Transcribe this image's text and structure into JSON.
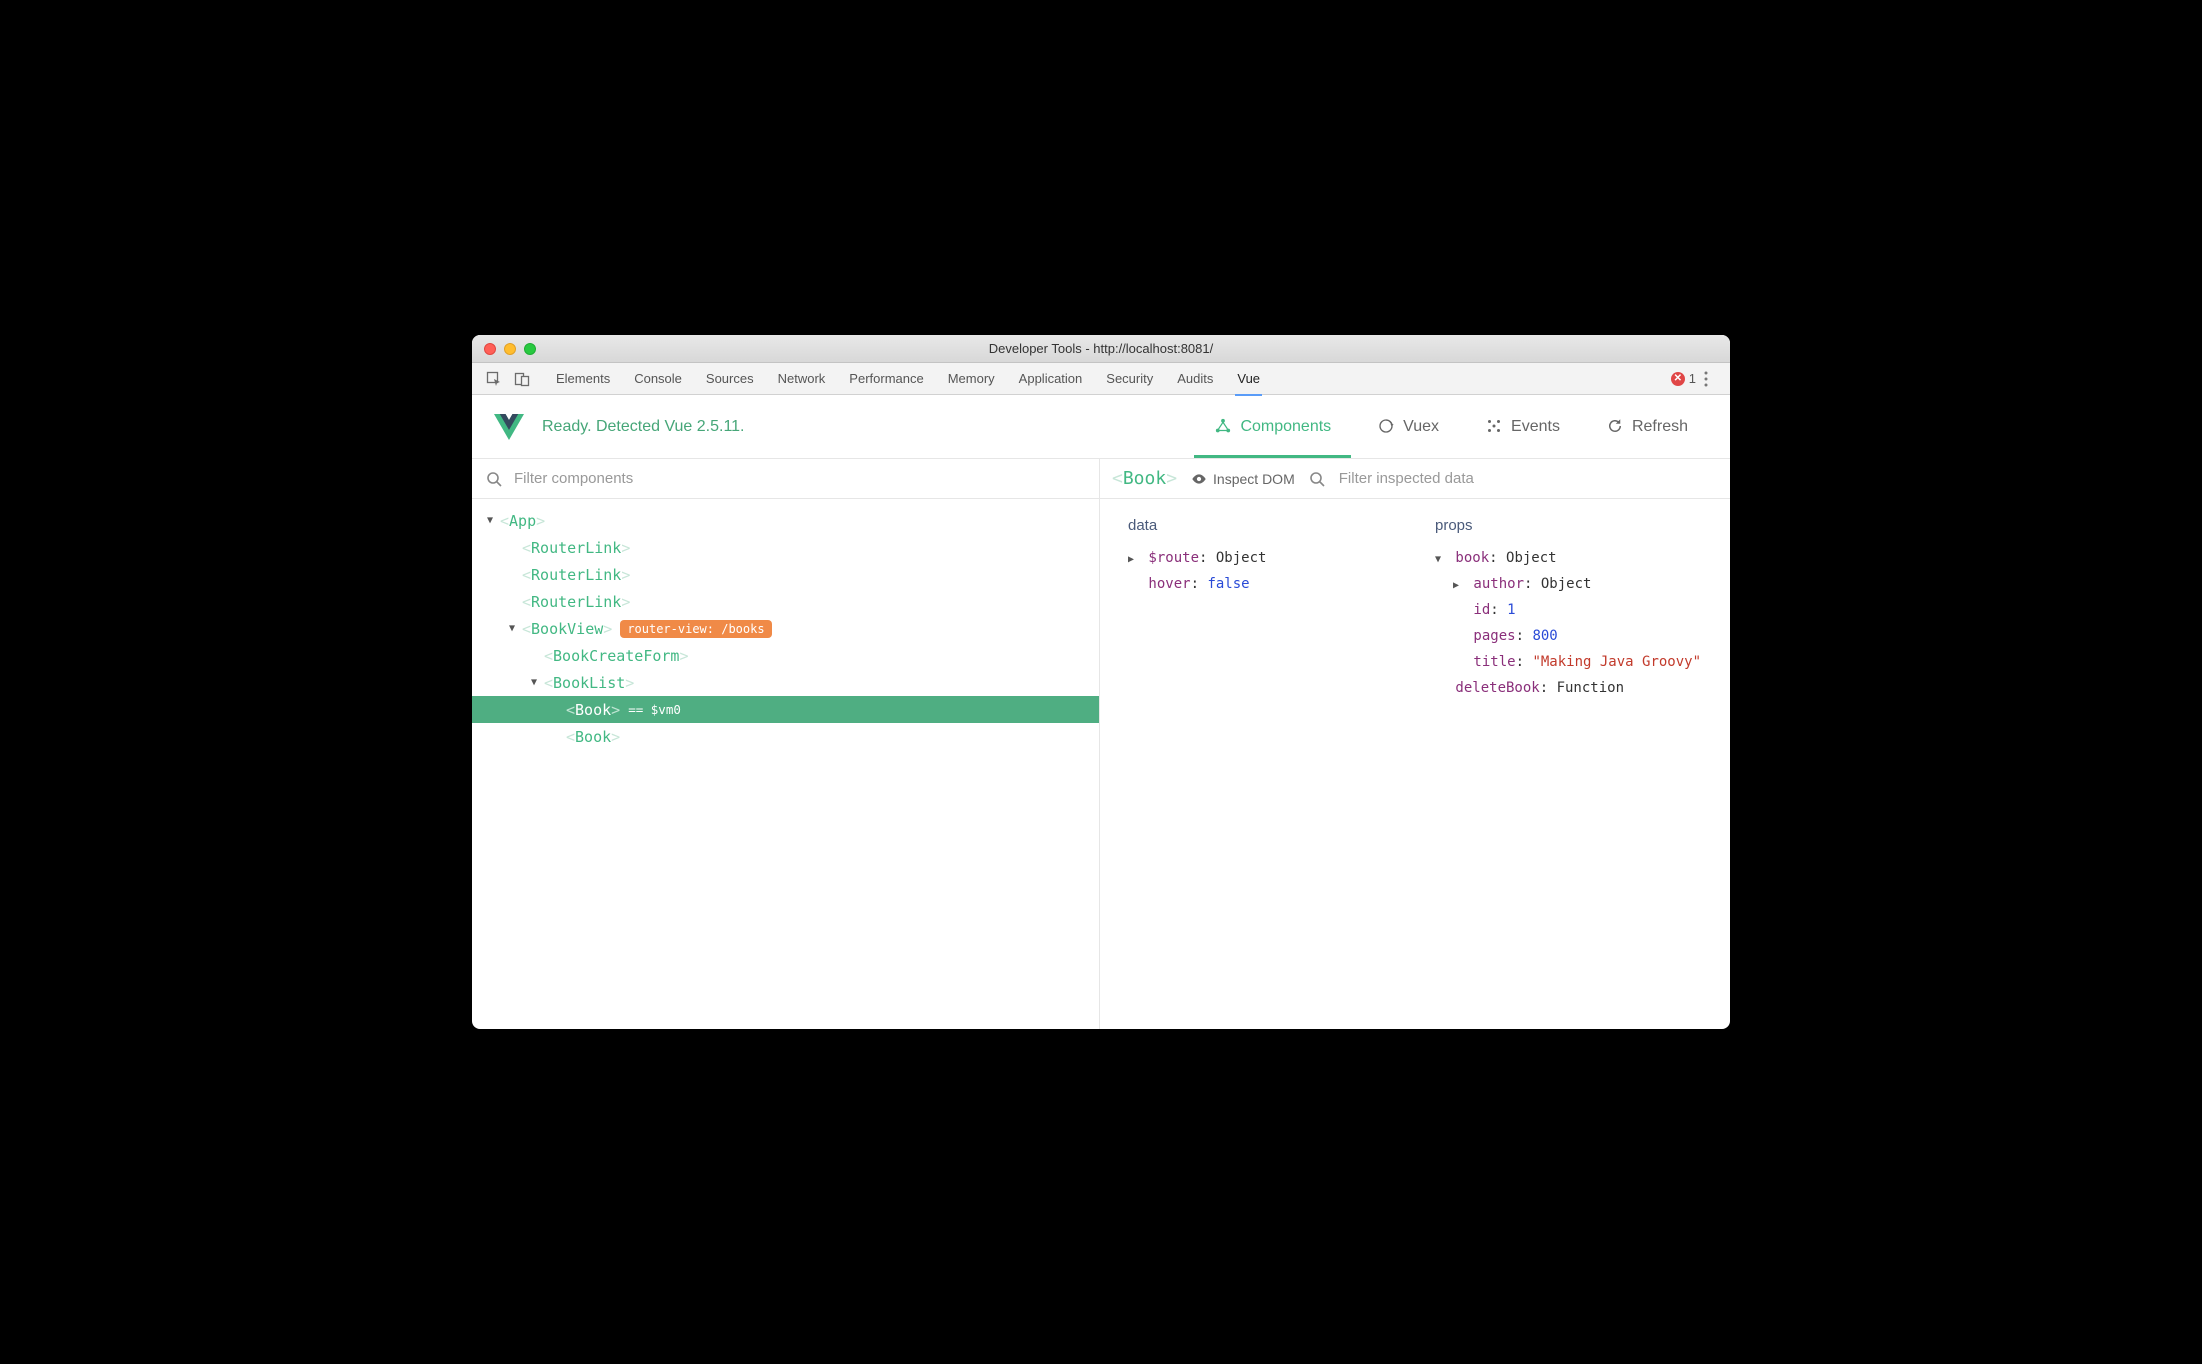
{
  "window": {
    "title": "Developer Tools - http://localhost:8081/"
  },
  "devtools": {
    "tabs": [
      "Elements",
      "Console",
      "Sources",
      "Network",
      "Performance",
      "Memory",
      "Application",
      "Security",
      "Audits",
      "Vue"
    ],
    "active_tab": "Vue",
    "error_count": "1"
  },
  "vue_status": {
    "message": "Ready. Detected Vue 2.5.11.",
    "tabs": [
      {
        "label": "Components",
        "active": true
      },
      {
        "label": "Vuex",
        "active": false
      },
      {
        "label": "Events",
        "active": false
      },
      {
        "label": "Refresh",
        "active": false
      }
    ]
  },
  "tree": {
    "filter_placeholder": "Filter components",
    "nodes": [
      {
        "depth": 0,
        "arrow": "down",
        "name": "App",
        "selected": false
      },
      {
        "depth": 1,
        "arrow": "none",
        "name": "RouterLink",
        "selected": false
      },
      {
        "depth": 1,
        "arrow": "none",
        "name": "RouterLink",
        "selected": false
      },
      {
        "depth": 1,
        "arrow": "none",
        "name": "RouterLink",
        "selected": false
      },
      {
        "depth": 1,
        "arrow": "down",
        "name": "BookView",
        "selected": false,
        "badge": "router-view: /books"
      },
      {
        "depth": 2,
        "arrow": "none",
        "name": "BookCreateForm",
        "selected": false
      },
      {
        "depth": 2,
        "arrow": "down",
        "name": "BookList",
        "selected": false
      },
      {
        "depth": 3,
        "arrow": "none",
        "name": "Book",
        "selected": true,
        "vm": "== $vm0"
      },
      {
        "depth": 3,
        "arrow": "none",
        "name": "Book",
        "selected": false
      }
    ]
  },
  "inspector": {
    "crumb": "Book",
    "inspect_label": "Inspect DOM",
    "filter_placeholder": "Filter inspected data",
    "data_heading": "data",
    "props_heading": "props",
    "data_rows": [
      {
        "indent": 0,
        "arrow": "right",
        "key": "$route",
        "value": "Object",
        "type": "type"
      },
      {
        "indent": 0,
        "arrow": "none",
        "key": "hover",
        "value": "false",
        "type": "bool"
      }
    ],
    "props_rows": [
      {
        "indent": 0,
        "arrow": "down",
        "key": "book",
        "value": "Object",
        "type": "type"
      },
      {
        "indent": 1,
        "arrow": "right",
        "key": "author",
        "value": "Object",
        "type": "type"
      },
      {
        "indent": 1,
        "arrow": "none",
        "key": "id",
        "value": "1",
        "type": "num"
      },
      {
        "indent": 1,
        "arrow": "none",
        "key": "pages",
        "value": "800",
        "type": "num"
      },
      {
        "indent": 1,
        "arrow": "none",
        "key": "title",
        "value": "\"Making Java Groovy\"",
        "type": "str"
      },
      {
        "indent": 0,
        "arrow": "none",
        "key": "deleteBook",
        "value": "Function",
        "type": "type"
      }
    ]
  }
}
